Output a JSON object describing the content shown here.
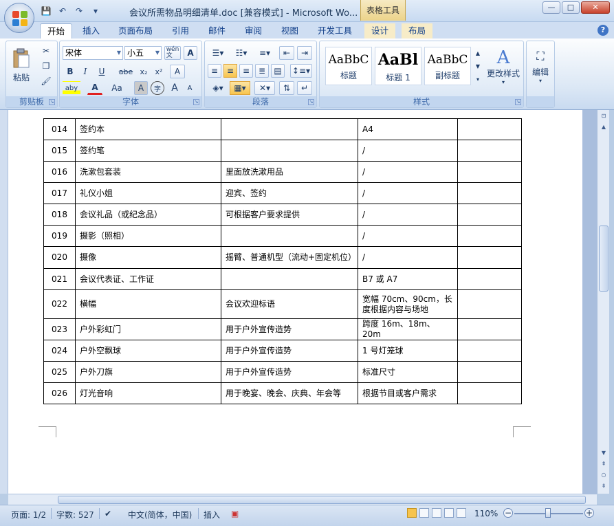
{
  "window": {
    "title": "会议所需物品明细清单.doc [兼容模式] - Microsoft Wo...",
    "context_tab_label": "表格工具",
    "minimize_label": "—",
    "maximize_label": "□",
    "close_label": "✕"
  },
  "qat": {
    "save_icon": "💾",
    "undo_icon": "↶",
    "redo_icon": "↷",
    "customize_icon": "▾"
  },
  "tabs": [
    {
      "label": "开始",
      "active": true
    },
    {
      "label": "插入"
    },
    {
      "label": "页面布局"
    },
    {
      "label": "引用"
    },
    {
      "label": "邮件"
    },
    {
      "label": "审阅"
    },
    {
      "label": "视图"
    },
    {
      "label": "开发工具"
    },
    {
      "label": "设计"
    },
    {
      "label": "布局"
    }
  ],
  "help_label": "?",
  "ribbon": {
    "clipboard": {
      "label": "剪贴板",
      "paste_label": "粘贴"
    },
    "font": {
      "label": "字体",
      "font_name": "宋体",
      "font_size": "小五",
      "wen_label": "wén\n文",
      "border_a_label": "A",
      "bold": "B",
      "italic": "I",
      "underline": "U",
      "strike": "abe",
      "subscript": "x₂",
      "superscript": "x²",
      "clear_format": "A",
      "highlight": "aby",
      "font_color": "A",
      "change_case": "Aa",
      "shade_char": "A",
      "enclose_char": "字",
      "grow": "A",
      "shrink": "A"
    },
    "paragraph": {
      "label": "段落"
    },
    "styles": {
      "label": "样式",
      "items": [
        {
          "sample": "AaBbC",
          "name": "标题"
        },
        {
          "sample": "AaBl",
          "name": "标题 1"
        },
        {
          "sample": "AaBbC",
          "name": "副标题"
        }
      ],
      "change_styles_label": "更改样式"
    },
    "editing": {
      "label": "编辑"
    }
  },
  "table_rows": [
    {
      "no": "014",
      "name": "签约本",
      "note": "",
      "spec": "A4",
      "extra": ""
    },
    {
      "no": "015",
      "name": "签约笔",
      "note": "",
      "spec": "/",
      "extra": ""
    },
    {
      "no": "016",
      "name": "洗漱包套装",
      "note": "里面放洗漱用品",
      "spec": "/",
      "extra": ""
    },
    {
      "no": "017",
      "name": "礼仪小姐",
      "note": "迎宾、签约",
      "spec": "/",
      "extra": ""
    },
    {
      "no": "018",
      "name": "会议礼品（或纪念品）",
      "note": "可根据客户要求提供",
      "spec": "/",
      "extra": ""
    },
    {
      "no": "019",
      "name": "摄影（照相）",
      "note": "",
      "spec": "/",
      "extra": ""
    },
    {
      "no": "020",
      "name": "摄像",
      "note": "摇臂、普通机型（流动+固定机位）",
      "spec": "/",
      "extra": ""
    },
    {
      "no": "021",
      "name": "会议代表证、工作证",
      "note": "",
      "spec": "B7 或 A7",
      "extra": ""
    },
    {
      "no": "022",
      "name": "横幅",
      "note": "会议欢迎标语",
      "spec": "宽幅 70cm、90cm，长度根据内容与场地",
      "extra": ""
    },
    {
      "no": "023",
      "name": "户外彩虹门",
      "note": "用于户外宣传造势",
      "spec": "跨度 16m、18m、20m",
      "extra": ""
    },
    {
      "no": "024",
      "name": "户外空飘球",
      "note": "用于户外宣传造势",
      "spec": "1 号灯笼球",
      "extra": ""
    },
    {
      "no": "025",
      "name": "户外刀旗",
      "note": "用于户外宣传造势",
      "spec": "标准尺寸",
      "extra": ""
    },
    {
      "no": "026",
      "name": "灯光音响",
      "note": "用于晚宴、晚会、庆典、年会等",
      "spec": "根据节目或客户需求",
      "extra": ""
    }
  ],
  "status": {
    "page": "页面: 1/2",
    "words": "字数: 527",
    "language": "中文(简体，中国)",
    "insert_mode": "插入",
    "zoom": "110%",
    "zoom_out": "−",
    "zoom_in": "+"
  }
}
